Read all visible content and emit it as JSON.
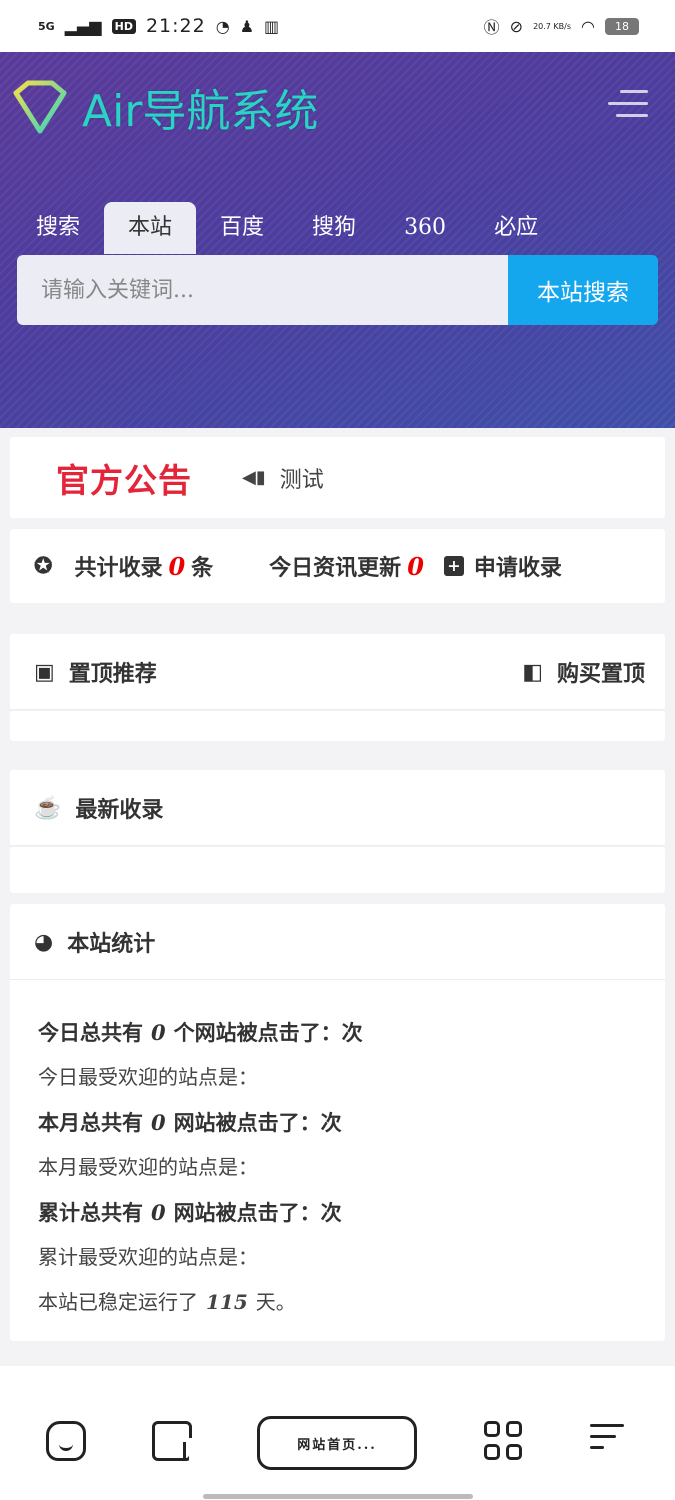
{
  "status_bar": {
    "network": "5G",
    "hd": "HD",
    "time": "21:22",
    "speed": "20.7 KB/s",
    "battery": "18"
  },
  "header": {
    "logo_text": "Air导航系统",
    "tabs": [
      {
        "label": "搜索"
      },
      {
        "label": "本站"
      },
      {
        "label": "百度"
      },
      {
        "label": "搜狗"
      },
      {
        "label": "360"
      },
      {
        "label": "必应"
      }
    ],
    "active_tab": "本站",
    "search_placeholder": "请输入关键词...",
    "search_button": "本站搜索"
  },
  "notice": {
    "logo_text": "官方公告",
    "text": "测试"
  },
  "stats": {
    "total_label": "共计收录",
    "total_value": "0",
    "total_unit": "条",
    "today_label": "今日资讯更新",
    "today_value": "0",
    "apply_label": "申请收录"
  },
  "top_recommend": {
    "title": "置顶推荐",
    "buy_label": "购买置顶"
  },
  "latest": {
    "title": "最新收录"
  },
  "site_stats": {
    "title": "本站统计",
    "lines": [
      {
        "pre": "今日总共有",
        "num": "0",
        "post": "个网站被点击了：次",
        "bold": true
      },
      {
        "text": "今日最受欢迎的站点是：",
        "bold": false
      },
      {
        "pre": "本月总共有",
        "num": "0",
        "post": "网站被点击了：次",
        "bold": true
      },
      {
        "text": "本月最受欢迎的站点是：",
        "bold": false
      },
      {
        "pre": "累计总共有",
        "num": "0",
        "post": "网站被点击了：次",
        "bold": true
      },
      {
        "text": "累计最受欢迎的站点是：",
        "bold": false
      },
      {
        "pre": "本站已稳定运行了",
        "num": "115",
        "post": "天。",
        "bold": false
      }
    ]
  },
  "bottom_bar": {
    "address_label": "网站首页..."
  },
  "colors": {
    "accent": "#14a7ee",
    "header_bg": "#4b3d9e",
    "notice_red": "#e3253a",
    "count_red": "#ee0000"
  }
}
